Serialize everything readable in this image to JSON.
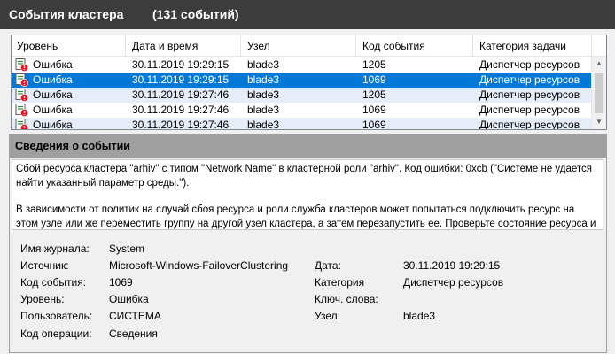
{
  "header": {
    "title": "События кластера",
    "count": "(131 событий)"
  },
  "table": {
    "columns": [
      "Уровень",
      "Дата и время",
      "Узел",
      "Код события",
      "Категория задачи"
    ],
    "rows": [
      {
        "level": "Ошибка",
        "datetime": "30.11.2019 19:29:15",
        "node": "blade3",
        "event_id": "1205",
        "category": "Диспетчер ресурсов",
        "state": "normal"
      },
      {
        "level": "Ошибка",
        "datetime": "30.11.2019 19:29:15",
        "node": "blade3",
        "event_id": "1069",
        "category": "Диспетчер ресурсов",
        "state": "selected"
      },
      {
        "level": "Ошибка",
        "datetime": "30.11.2019 19:27:46",
        "node": "blade3",
        "event_id": "1205",
        "category": "Диспетчер ресурсов",
        "state": "alt"
      },
      {
        "level": "Ошибка",
        "datetime": "30.11.2019 19:27:46",
        "node": "blade3",
        "event_id": "1069",
        "category": "Диспетчер ресурсов",
        "state": "normal"
      },
      {
        "level": "Ошибка",
        "datetime": "30.11.2019 19:27:46",
        "node": "blade3",
        "event_id": "1069",
        "category": "Диспетчер ресурсов",
        "state": "alt"
      }
    ]
  },
  "details": {
    "title": "Сведения о событии",
    "description_p1": "Сбой ресурса кластера \"arhiv\" с типом \"Network Name\" в кластерной роли \"arhiv\". Код ошибки: 0xcb (\"Системе не удается найти указанный параметр среды.\").",
    "description_p2": "В зависимости от политик на случай сбоя ресурса и роли служба кластеров может попытаться подключить ресурс на этом узле или же переместить группу на другой узел кластера, а затем перезапустить ее. Проверьте состояние ресурса и группы с помощью диспетчера отказоустойчивости кластеров или командлета Get-ClusterResource оболочки Windows PowerShell.",
    "props": {
      "log_label": "Имя журнала:",
      "log_value": "System",
      "source_label": "Источник:",
      "source_value": "Microsoft-Windows-FailoverClustering",
      "event_label": "Код события:",
      "event_value": "1069",
      "level_label": "Уровень:",
      "level_value": "Ошибка",
      "user_label": "Пользователь:",
      "user_value": "СИСТЕМА",
      "opcode_label": "Код операции:",
      "opcode_value": "Сведения",
      "date_label": "Дата:",
      "date_value": "30.11.2019 19:29:15",
      "category_label": "Категория",
      "category_value": "Диспетчер ресурсов",
      "keywords_label": "Ключ. слова:",
      "keywords_value": "",
      "node_label": "Узел:",
      "node_value": "blade3"
    }
  },
  "colors": {
    "title_bar": "#3c3c3c",
    "selection": "#0078d7",
    "alt_row": "#e6ecf8",
    "details_header": "#a0a0a0",
    "error_icon": "#e81123"
  },
  "icons": {
    "level": "error-log-icon",
    "scroll_up": "scroll-up-arrow-icon",
    "scroll_down": "scroll-down-arrow-icon"
  }
}
